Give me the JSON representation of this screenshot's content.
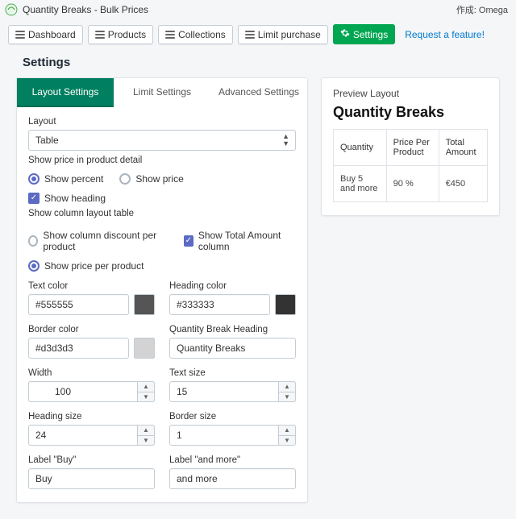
{
  "titlebar": {
    "title": "Quantity Breaks - Bulk Prices",
    "author": "作成: Omega"
  },
  "nav": {
    "dashboard": "Dashboard",
    "products": "Products",
    "collections": "Collections",
    "limit": "Limit purchase",
    "settings": "Settings",
    "feature": "Request a feature!"
  },
  "page": {
    "title": "Settings"
  },
  "tabs": {
    "layout": "Layout Settings",
    "limit": "Limit Settings",
    "advanced": "Advanced Settings"
  },
  "layout": {
    "label": "Layout",
    "value": "Table",
    "note": "Show price in product detail",
    "percent": "Show percent",
    "price": "Show price",
    "heading_chk": "Show heading",
    "col_note": "Show column layout table",
    "discount_col": "Show column discount per product",
    "total_col": "Show Total Amount column",
    "price_per": "Show price per product"
  },
  "fields": {
    "text_color": {
      "label": "Text color",
      "value": "#555555"
    },
    "heading_color": {
      "label": "Heading color",
      "value": "#333333"
    },
    "border_color": {
      "label": "Border color",
      "value": "#d3d3d3"
    },
    "qb_heading": {
      "label": "Quantity Break Heading",
      "value": "Quantity Breaks"
    },
    "width": {
      "label": "Width",
      "prefix": "%",
      "value": "100"
    },
    "text_size": {
      "label": "Text size",
      "value": "15"
    },
    "heading_size": {
      "label": "Heading size",
      "value": "24"
    },
    "border_size": {
      "label": "Border size",
      "value": "1"
    },
    "label_buy": {
      "label": "Label \"Buy\"",
      "value": "Buy"
    },
    "label_more": {
      "label": "Label \"and more\"",
      "value": "and more"
    }
  },
  "preview": {
    "title": "Preview Layout",
    "heading": "Quantity Breaks",
    "cols": {
      "qty": "Quantity",
      "ppp": "Price Per Product",
      "total": "Total Amount"
    },
    "row": {
      "qty": "Buy 5 and more",
      "ppp": "90 %",
      "total": "€450"
    }
  },
  "colors": {
    "text_swatch": "#555555",
    "heading_swatch": "#333333",
    "border_swatch": "#d3d3d3"
  }
}
